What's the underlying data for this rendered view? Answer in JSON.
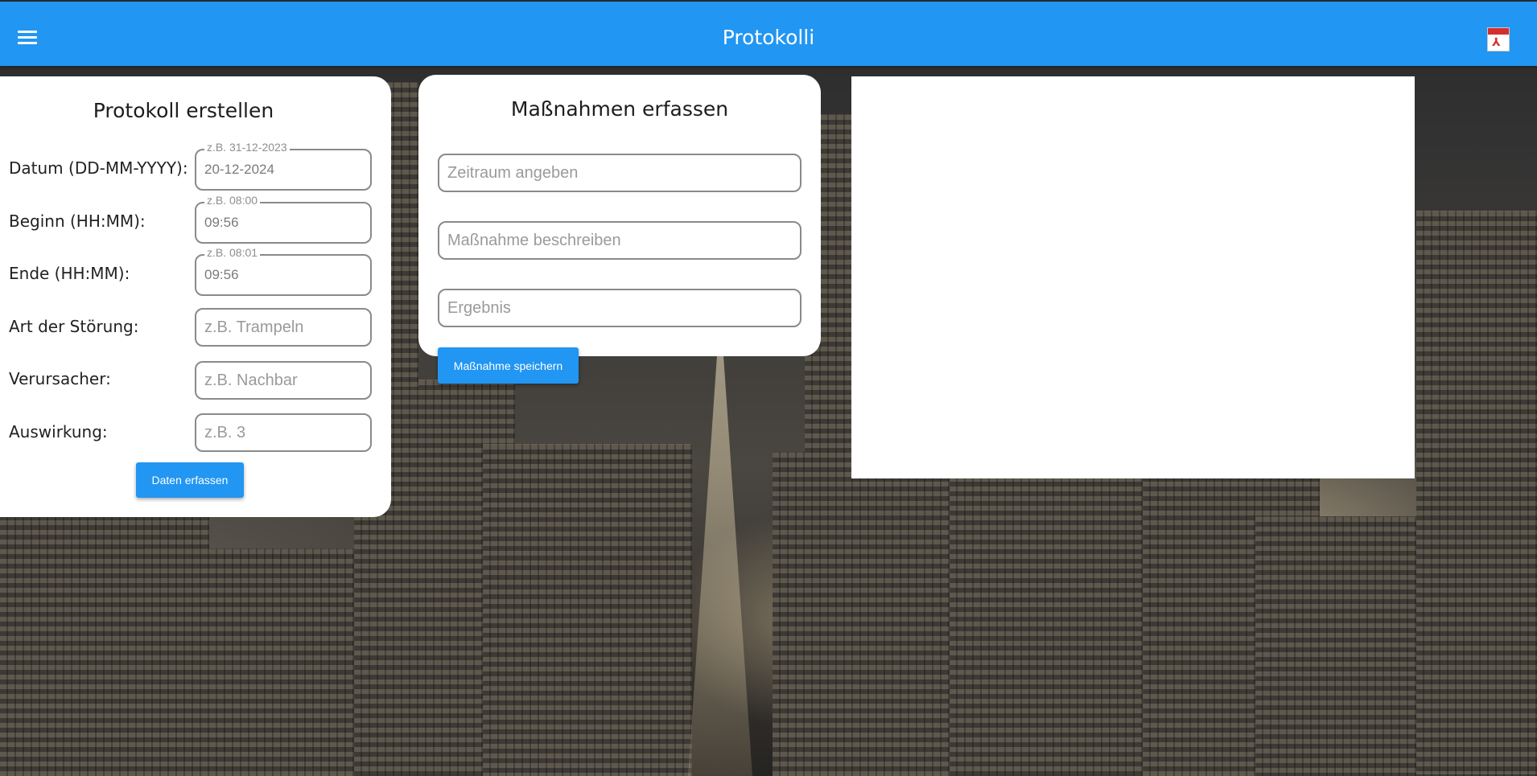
{
  "appbar": {
    "title": "Protokolli",
    "pdf_icon_text": "PDF"
  },
  "protokoll": {
    "title": "Protokoll erstellen",
    "fields": [
      {
        "label": "Datum (DD-MM-YYYY):",
        "hint": "z.B. 31-12-2023",
        "value": "20-12-2024",
        "placeholder": ""
      },
      {
        "label": "Beginn (HH:MM):",
        "hint": "z.B. 08:00",
        "value": "09:56",
        "placeholder": ""
      },
      {
        "label": "Ende (HH:MM):",
        "hint": "z.B. 08:01",
        "value": "09:56",
        "placeholder": ""
      },
      {
        "label": "Art der Störung:",
        "hint": "",
        "value": "",
        "placeholder": "z.B. Trampeln"
      },
      {
        "label": "Verursacher:",
        "hint": "",
        "value": "",
        "placeholder": "z.B. Nachbar"
      },
      {
        "label": "Auswirkung:",
        "hint": "",
        "value": "",
        "placeholder": "z.B. 3"
      }
    ],
    "submit_label": "Daten erfassen"
  },
  "massnahmen": {
    "title": "Maßnahmen erfassen",
    "fields": [
      {
        "placeholder": "Zeitraum angeben",
        "value": ""
      },
      {
        "placeholder": "Maßnahme beschreiben",
        "value": ""
      },
      {
        "placeholder": "Ergebnis",
        "value": ""
      }
    ],
    "submit_label": "Maßnahme speichern"
  },
  "colors": {
    "primary": "#2196f3",
    "card_bg": "#ffffff",
    "pdf_red": "#d32f2f"
  },
  "icons": {
    "menu": "menu-icon",
    "pdf": "pdf-icon"
  }
}
